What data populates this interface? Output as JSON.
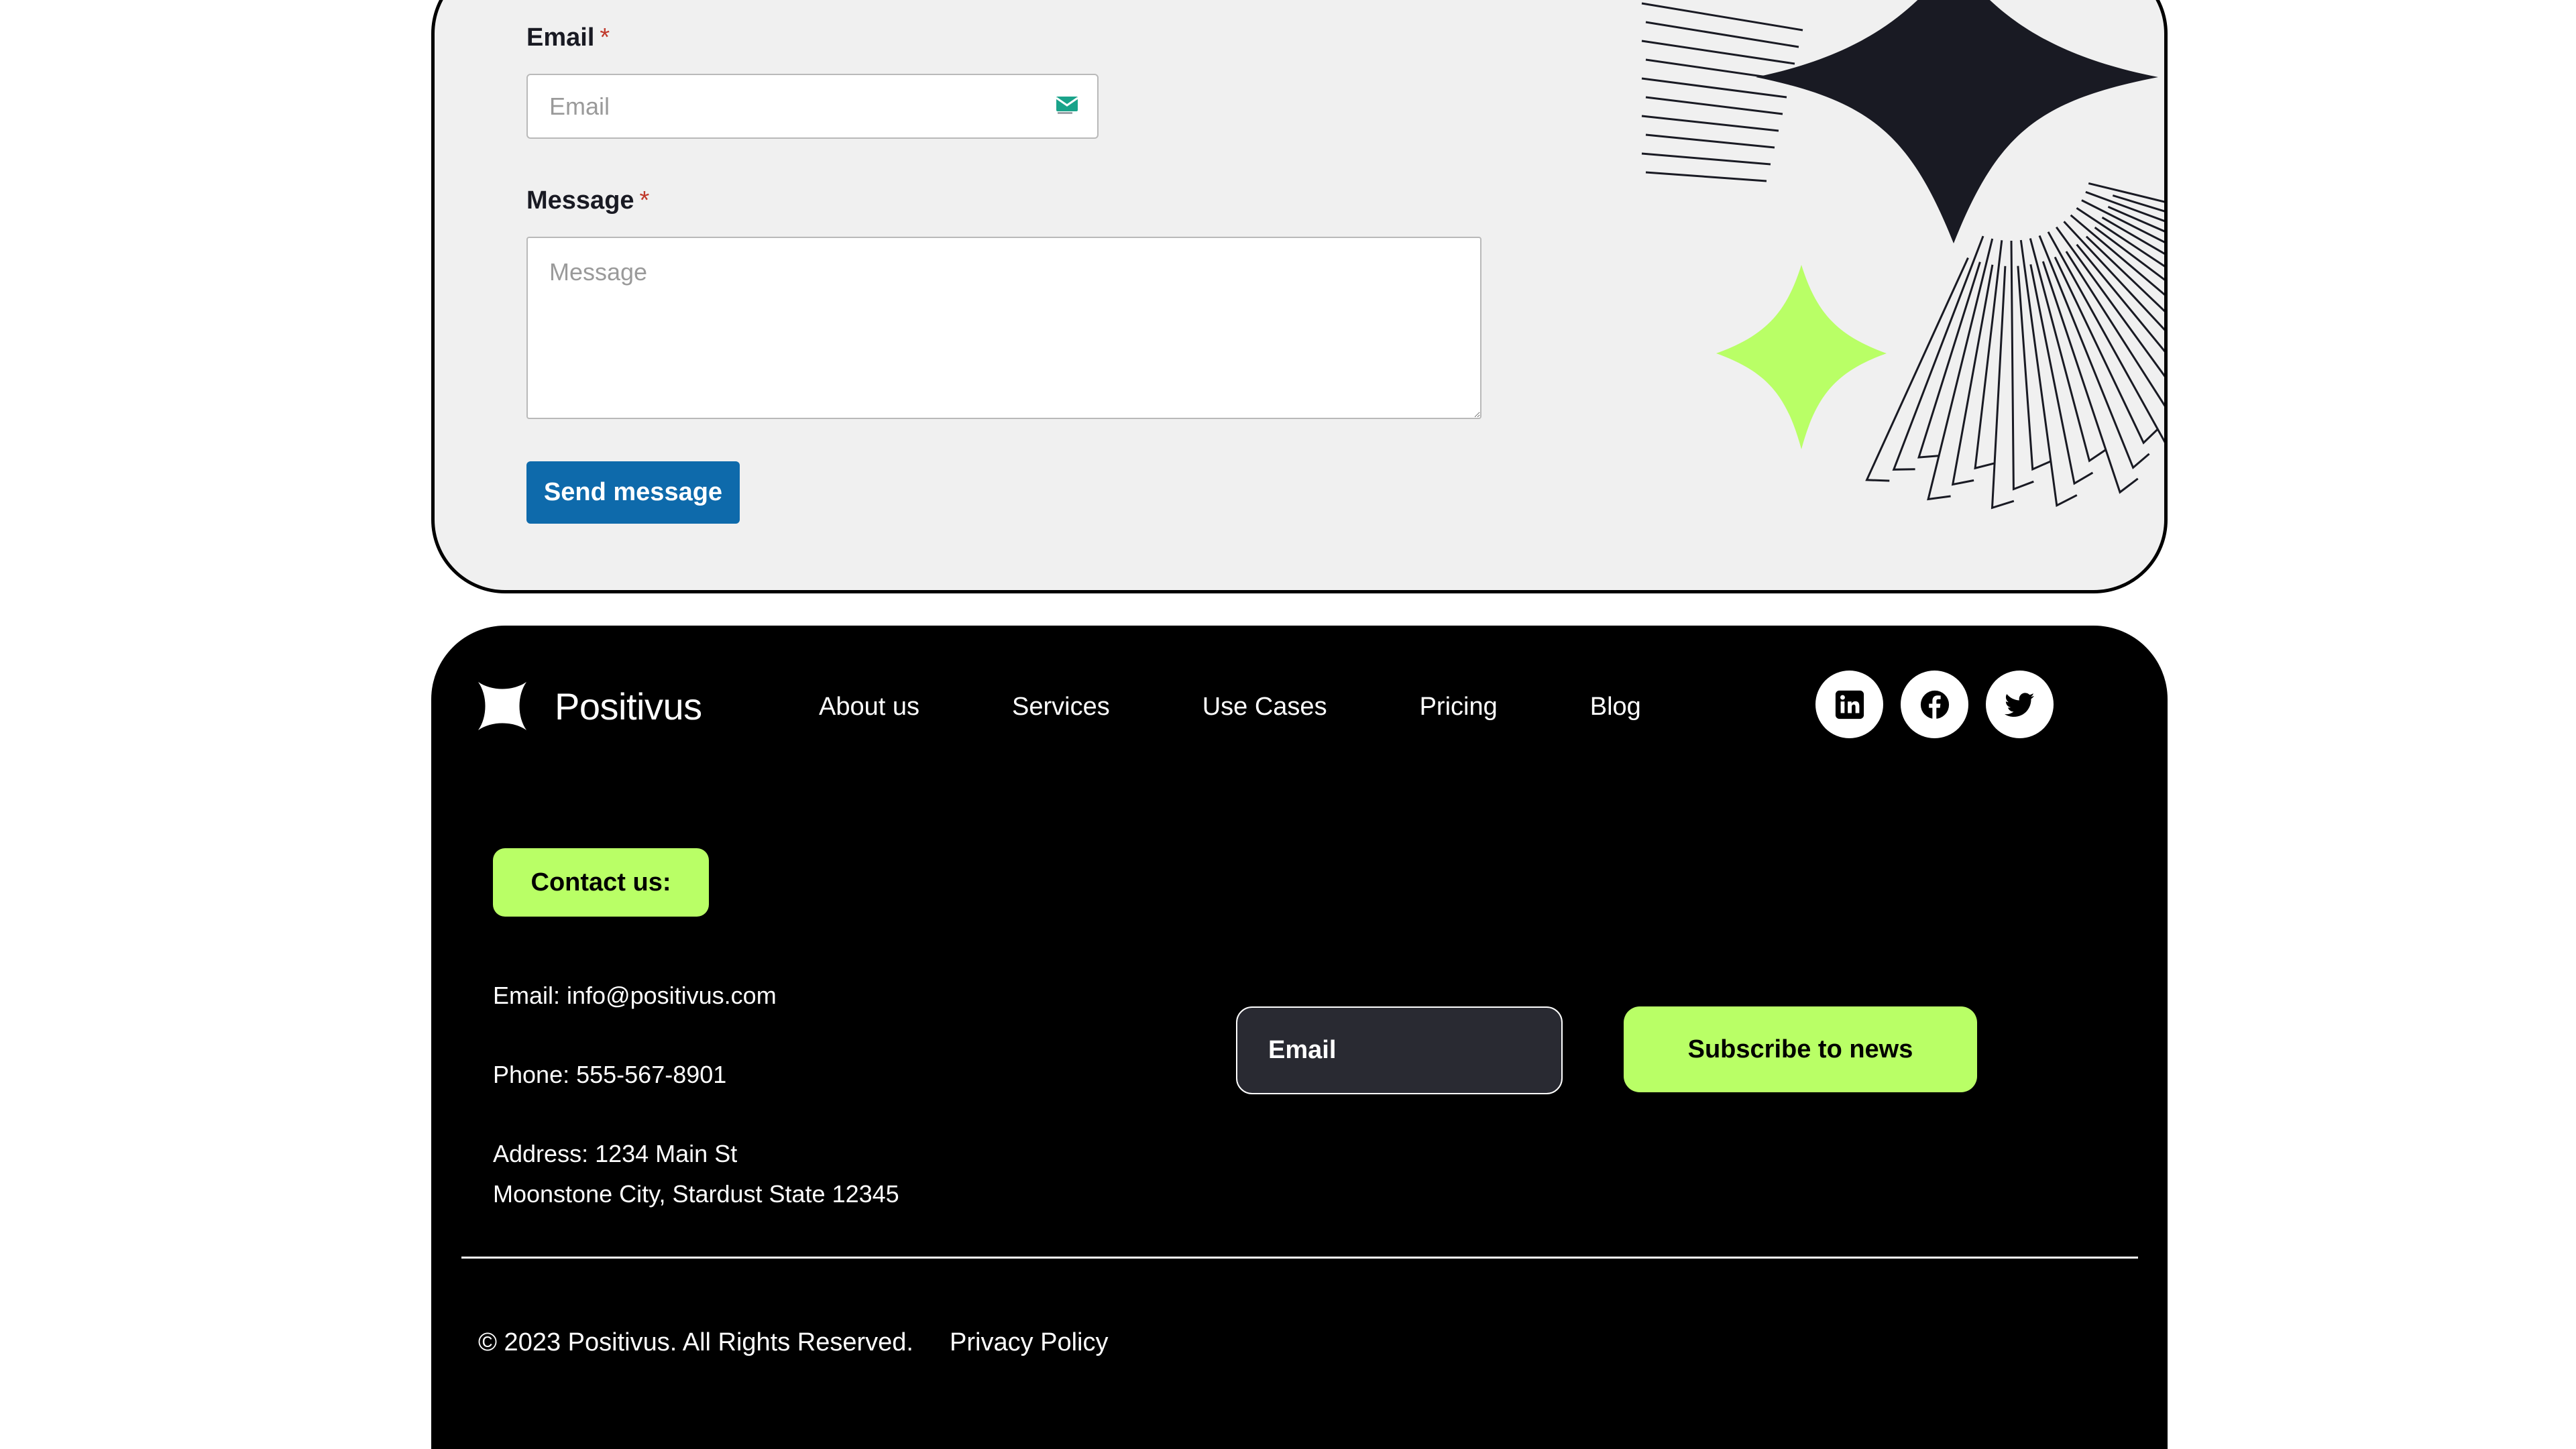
{
  "contact_form": {
    "email_label": "Email",
    "email_placeholder": "Email",
    "message_label": "Message",
    "message_placeholder": "Message",
    "required_marker": "*",
    "send_button_label": "Send message"
  },
  "footer": {
    "brand": "Positivus",
    "nav_links": [
      "About us",
      "Services",
      "Use Cases",
      "Pricing",
      "Blog"
    ],
    "socials": [
      "linkedin-icon",
      "facebook-icon",
      "twitter-icon"
    ],
    "contact_badge": "Contact us:",
    "contact_email": "Email: info@positivus.com",
    "contact_phone": "Phone: 555-567-8901",
    "contact_address_line1": "Address: 1234 Main St",
    "contact_address_line2": "Moonstone City, Stardust State 12345",
    "subscribe_placeholder": "Email",
    "subscribe_button": "Subscribe to news",
    "copyright": "© 2023 Positivus. All Rights Reserved.",
    "privacy_link": "Privacy Policy"
  },
  "colors": {
    "accent_green": "#b9ff66",
    "dark": "#191a23",
    "button_blue": "#0e6aab",
    "form_bg": "#f0f0f0"
  }
}
